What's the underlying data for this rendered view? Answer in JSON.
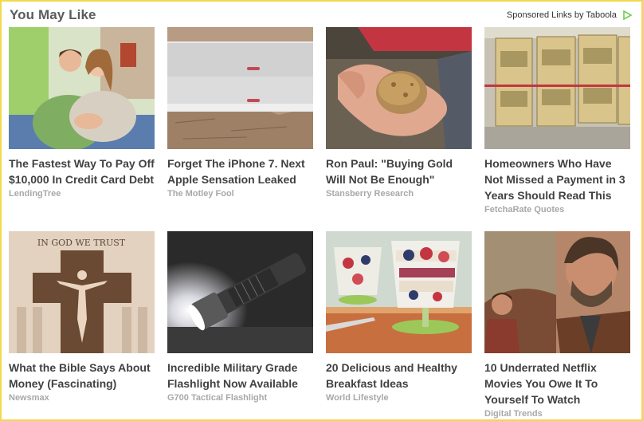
{
  "widget": {
    "title": "You May Like",
    "sponsored_label": "Sponsored Links by Taboola",
    "accent_color": "#f2d94a"
  },
  "cards": [
    {
      "headline": "The Fastest Way To Pay Off $10,000 In Credit Card Debt",
      "source": "LendingTree",
      "image": "couple-on-couch-photo"
    },
    {
      "headline": "Forget The iPhone 7. Next Apple Sensation Leaked",
      "source": "The Motley Fool",
      "image": "iphone-on-wood-photo"
    },
    {
      "headline": "Ron Paul: \"Buying Gold Will Not Be Enough\"",
      "source": "Stansberry Research",
      "image": "gold-nugget-hand-photo"
    },
    {
      "headline": "Homeowners Who Have Not Missed a Payment in 3 Years Should Read This",
      "source": "FetchaRate Quotes",
      "image": "dollar-bills-photo"
    },
    {
      "headline": "What the Bible Says About Money (Fascinating)",
      "source": "Newsmax",
      "image": "in-god-we-trust-photo"
    },
    {
      "headline": "Incredible Military Grade Flashlight Now Available",
      "source": "G700 Tactical Flashlight",
      "image": "flashlight-photo"
    },
    {
      "headline": "20 Delicious and Healthy Breakfast Ideas",
      "source": "World Lifestyle",
      "image": "parfait-photo"
    },
    {
      "headline": "10 Underrated Netflix Movies You Owe It To Yourself To Watch",
      "source": "Digital Trends",
      "image": "bearded-man-photo"
    }
  ]
}
